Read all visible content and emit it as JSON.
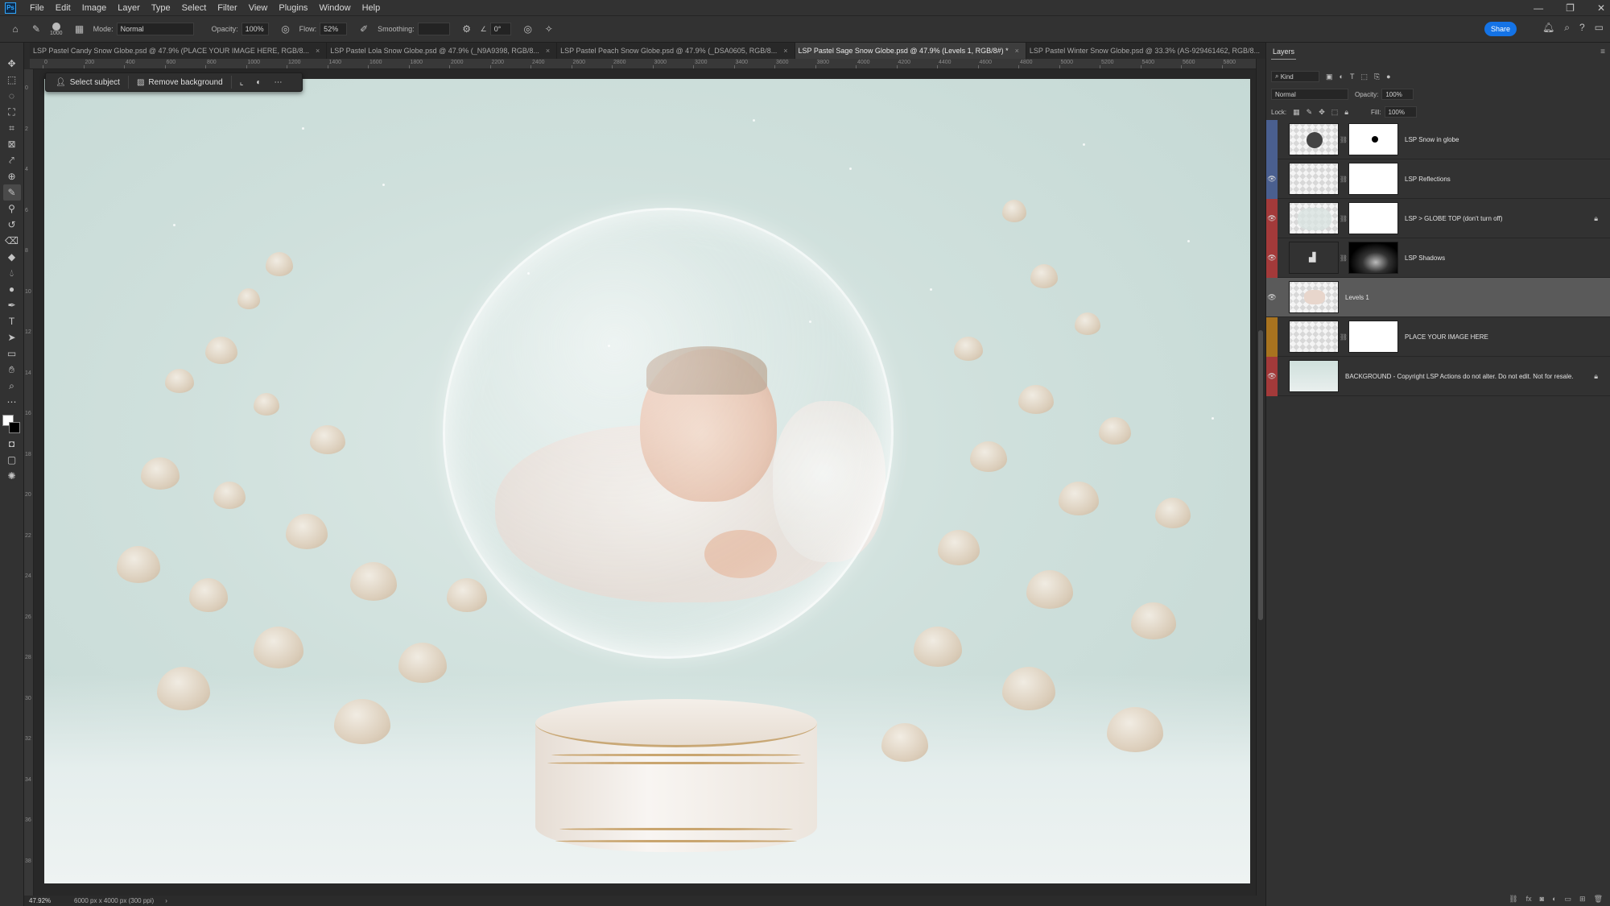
{
  "app": {
    "logo": "Ps"
  },
  "menu": [
    "File",
    "Edit",
    "Image",
    "Layer",
    "Type",
    "Select",
    "Filter",
    "View",
    "Plugins",
    "Window",
    "Help"
  ],
  "window_controls": [
    "—",
    "❐",
    "✕"
  ],
  "options": {
    "brush_size": "1000",
    "mode_label": "Mode:",
    "mode_value": "Normal",
    "opacity_label": "Opacity:",
    "opacity_value": "100%",
    "flow_label": "Flow:",
    "flow_value": "52%",
    "smoothing_label": "Smoothing:",
    "angle_value": "0°",
    "share_label": "Share"
  },
  "tabs": [
    {
      "label": "LSP Pastel Candy Snow Globe.psd @ 47.9% (PLACE YOUR IMAGE HERE, RGB/8...",
      "active": false
    },
    {
      "label": "LSP Pastel Lola Snow Globe.psd @ 47.9% (_N9A9398, RGB/8...",
      "active": false
    },
    {
      "label": "LSP Pastel Peach Snow Globe.psd @ 47.9% (_DSA0605, RGB/8...",
      "active": false
    },
    {
      "label": "LSP Pastel Sage Snow Globe.psd @ 47.9% (Levels 1, RGB/8#) *",
      "active": true
    },
    {
      "label": "LSP Pastel Winter Snow Globe.psd @ 33.3% (AS-929461462, RGB/8...",
      "active": false
    }
  ],
  "ruler_top": [
    "0",
    "200",
    "400",
    "600",
    "800",
    "1000",
    "1200",
    "1400",
    "1600",
    "1800",
    "2000",
    "2200",
    "2400",
    "2600",
    "2800",
    "3000",
    "3200",
    "3400",
    "3600",
    "3800",
    "4000",
    "4200",
    "4400",
    "4600",
    "4800",
    "5000",
    "5200",
    "5400",
    "5600",
    "5800"
  ],
  "ruler_left": [
    "0",
    "2",
    "4",
    "6",
    "8",
    "10",
    "12",
    "14",
    "16",
    "18",
    "20",
    "22",
    "24",
    "26",
    "28",
    "30",
    "32",
    "34",
    "36",
    "38"
  ],
  "context_bar": {
    "select_subject": "Select subject",
    "remove_background": "Remove background"
  },
  "status": {
    "zoom": "47.92%",
    "doc_info": "6000 px x 4000 px (300 ppi)"
  },
  "layers_panel": {
    "title": "Layers",
    "filter_label": "Kind",
    "blend_mode": "Normal",
    "opacity_label": "Opacity:",
    "opacity_value": "100%",
    "lock_label": "Lock:",
    "fill_label": "Fill:",
    "fill_value": "100%",
    "layers": [
      {
        "name": "LSP Snow in globe",
        "color": "#4a5f8f",
        "visible": false,
        "locked": false,
        "selected": false
      },
      {
        "name": "LSP Reflections",
        "color": "#4a5f8f",
        "visible": true,
        "locked": false,
        "selected": false
      },
      {
        "name": "LSP > GLOBE TOP (don't turn off)",
        "color": "#a33a3a",
        "visible": true,
        "locked": true,
        "selected": false
      },
      {
        "name": "LSP Shadows",
        "color": "#a33a3a",
        "visible": true,
        "locked": false,
        "selected": false
      },
      {
        "name": "Levels 1",
        "color": "",
        "visible": true,
        "locked": false,
        "selected": true
      },
      {
        "name": "PLACE YOUR IMAGE HERE",
        "color": "#a8731f",
        "visible": false,
        "locked": false,
        "selected": false
      },
      {
        "name": "BACKGROUND - Copyright LSP Actions do not alter. Do not edit. Not for resale.",
        "color": "#a33a3a",
        "visible": true,
        "locked": true,
        "selected": false
      }
    ]
  },
  "icons": {
    "home": "home-icon",
    "brush": "brush-icon",
    "eye": "eye-icon",
    "lock": "lock-icon",
    "link": "link-icon"
  }
}
